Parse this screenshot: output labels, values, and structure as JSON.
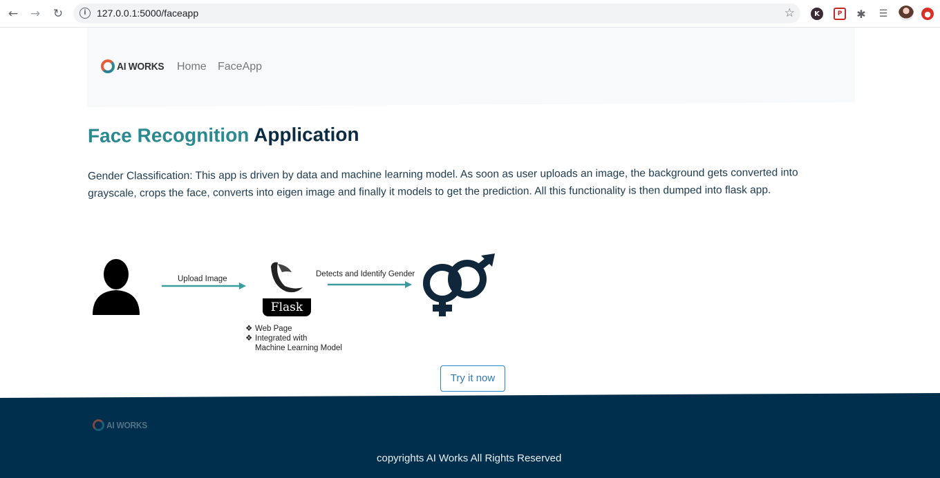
{
  "browser": {
    "url": "127.0.0.1:5000/faceapp",
    "extensions": {
      "k_label": "K",
      "pocket_label": "P"
    }
  },
  "navbar": {
    "brand": "AI WORKS",
    "links": [
      "Home",
      "FaceApp"
    ]
  },
  "page": {
    "title_part1": "Face Recognition",
    "title_part2": "Application",
    "description": "Gender Classification: This app is driven by data and machine learning model. As soon as user uploads an image, the background gets converted into grayscale, crops the face, converts into eigen image and finally it models to get the prediction. All this functionality is then dumped into flask app."
  },
  "diagram": {
    "upload_label": "Upload Image",
    "detect_label": "Detects and Identify Gender",
    "flask_label": "Flask",
    "bullets": [
      "Web Page",
      "Integrated with",
      "Machine Learning Model"
    ],
    "arrow_color": "#3a9c9e"
  },
  "cta": {
    "label": "Try it now"
  },
  "footer": {
    "brand": "AI WORKS",
    "copyright": "copyrights AI Works All Rights Reserved",
    "background": "#002f4d"
  },
  "colors": {
    "accent": "#2a8a8f",
    "heading": "#0d2b40",
    "button_border": "#2d88c5"
  }
}
